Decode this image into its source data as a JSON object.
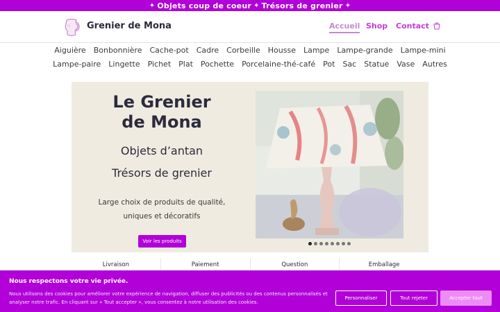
{
  "promo": {
    "icon_left": "star-icon",
    "text_left": "Objets coup de coeur",
    "icon_middle": "star-icon",
    "text_right": "Trésors de grenier",
    "icon_right": "star-icon"
  },
  "header": {
    "logo_icon": "pitcher-icon",
    "brand": "Grenier de Mona",
    "nav": [
      "Accueil",
      "Shop",
      "Contact"
    ],
    "active_nav": "Accueil",
    "cart_icon": "cart-icon"
  },
  "categories": {
    "row1": [
      "Aiguière",
      "Bonbonnière",
      "Cache-pot",
      "Cadre",
      "Corbeille",
      "Housse",
      "Lampe",
      "Lampe-grande",
      "Lampe-mini"
    ],
    "row2": [
      "Lampe-paire",
      "Lingette",
      "Pichet",
      "Plat",
      "Pochette",
      "Porcelaine-thé-café",
      "Pot",
      "Sac",
      "Statue",
      "Vase",
      "Autres"
    ]
  },
  "hero": {
    "title_line1": "Le Grenier",
    "title_line2": "de Mona",
    "subtitle1": "Objets d’antan",
    "subtitle2": "Trésors de grenier",
    "desc_line1": "Large choix de produits de qualité,",
    "desc_line2": "uniques et décoratifs",
    "button": "Voir les produits",
    "slide_count": 8,
    "active_slide": 1
  },
  "info": [
    "Livraison",
    "Paiement",
    "Question",
    "Emballage"
  ],
  "cookie": {
    "title": "Nous respectons votre vie privée.",
    "text": "Nous utilisons des cookies pour améliorer votre expérience de navigation, diffuser des publicités ou des contenus personnalisés et analyser notre trafic. En cliquant sur « Tout accepter », vous consentez à notre utilisation des cookies.",
    "btn_customize": "Personnaliser",
    "btn_reject": "Tout rejeter",
    "btn_accept": "Accepter tout"
  },
  "colors": {
    "accent": "#b100d8",
    "nav": "#c63bd9",
    "hero_bg": "#f0ebe0"
  }
}
